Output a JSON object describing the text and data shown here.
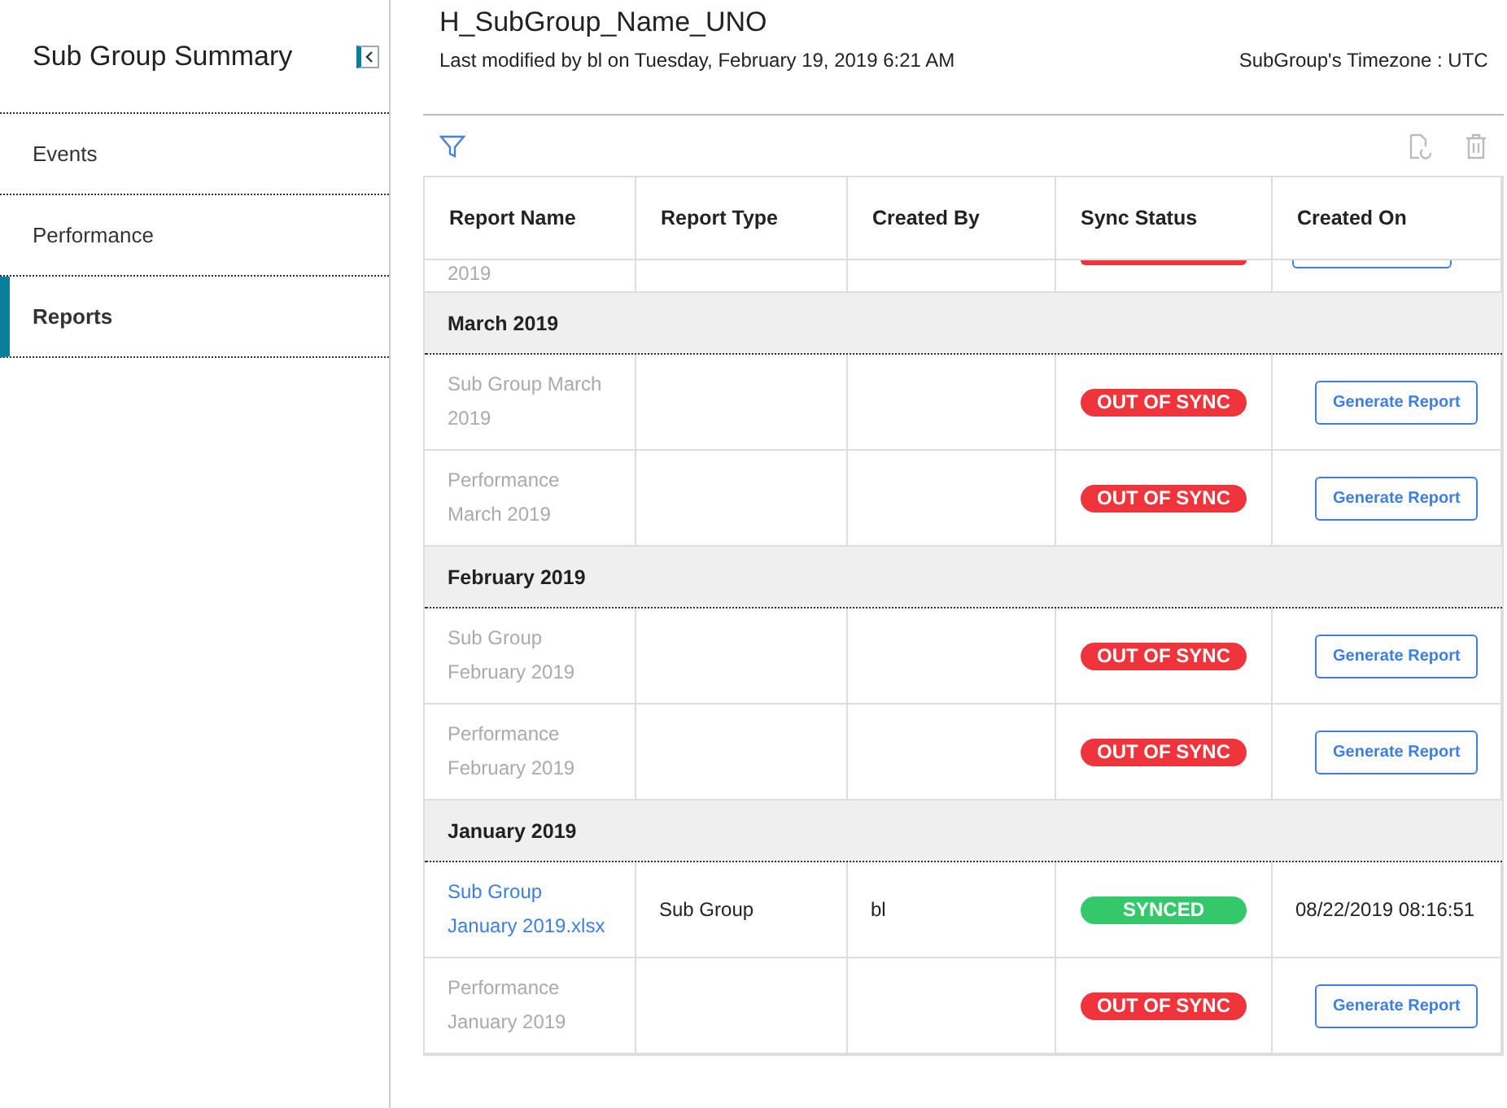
{
  "sidebar": {
    "title": "Sub Group Summary",
    "items": [
      {
        "label": "Events",
        "selected": false
      },
      {
        "label": "Performance",
        "selected": false
      },
      {
        "label": "Reports",
        "selected": true
      }
    ]
  },
  "header": {
    "title": "H_SubGroup_Name_UNO",
    "modified": "Last modified by bl on Tuesday, February 19, 2019 6:21 AM",
    "timezone": "SubGroup's Timezone : UTC"
  },
  "table": {
    "columns": [
      "Report Name",
      "Report Type",
      "Created By",
      "Sync Status",
      "Created On"
    ],
    "rows": [
      {
        "kind": "clipped",
        "name": "2019",
        "color": "#f0343c"
      },
      {
        "kind": "group",
        "name": "March 2019"
      },
      {
        "kind": "report",
        "name": "Sub Group March 2019",
        "color": "#f0343c",
        "status_label": "OUT OF SYNC",
        "action": "Generate Report"
      },
      {
        "kind": "report",
        "name": "Performance March 2019",
        "color": "#f0343c",
        "status_label": "OUT OF SYNC",
        "action": "Generate Report"
      },
      {
        "kind": "group",
        "name": "February 2019"
      },
      {
        "kind": "report",
        "name": "Sub Group February 2019",
        "color": "#f0343c",
        "status_label": "OUT OF SYNC",
        "action": "Generate Report"
      },
      {
        "kind": "report",
        "name": "Performance February 2019",
        "color": "#f0343c",
        "status_label": "OUT OF SYNC",
        "action": "Generate Report"
      },
      {
        "kind": "group",
        "name": "January 2019"
      },
      {
        "kind": "file",
        "name": "Sub Group January 2019.xlsx",
        "type": "Sub Group",
        "created_by": "bl",
        "color": "#34c86a",
        "status_label": "SYNCED",
        "created_on": "08/22/2019 08:16:51"
      },
      {
        "kind": "report",
        "name": "Performance January 2019",
        "color": "#f0343c",
        "status_label": "OUT OF SYNC",
        "action": "Generate Report"
      }
    ]
  }
}
